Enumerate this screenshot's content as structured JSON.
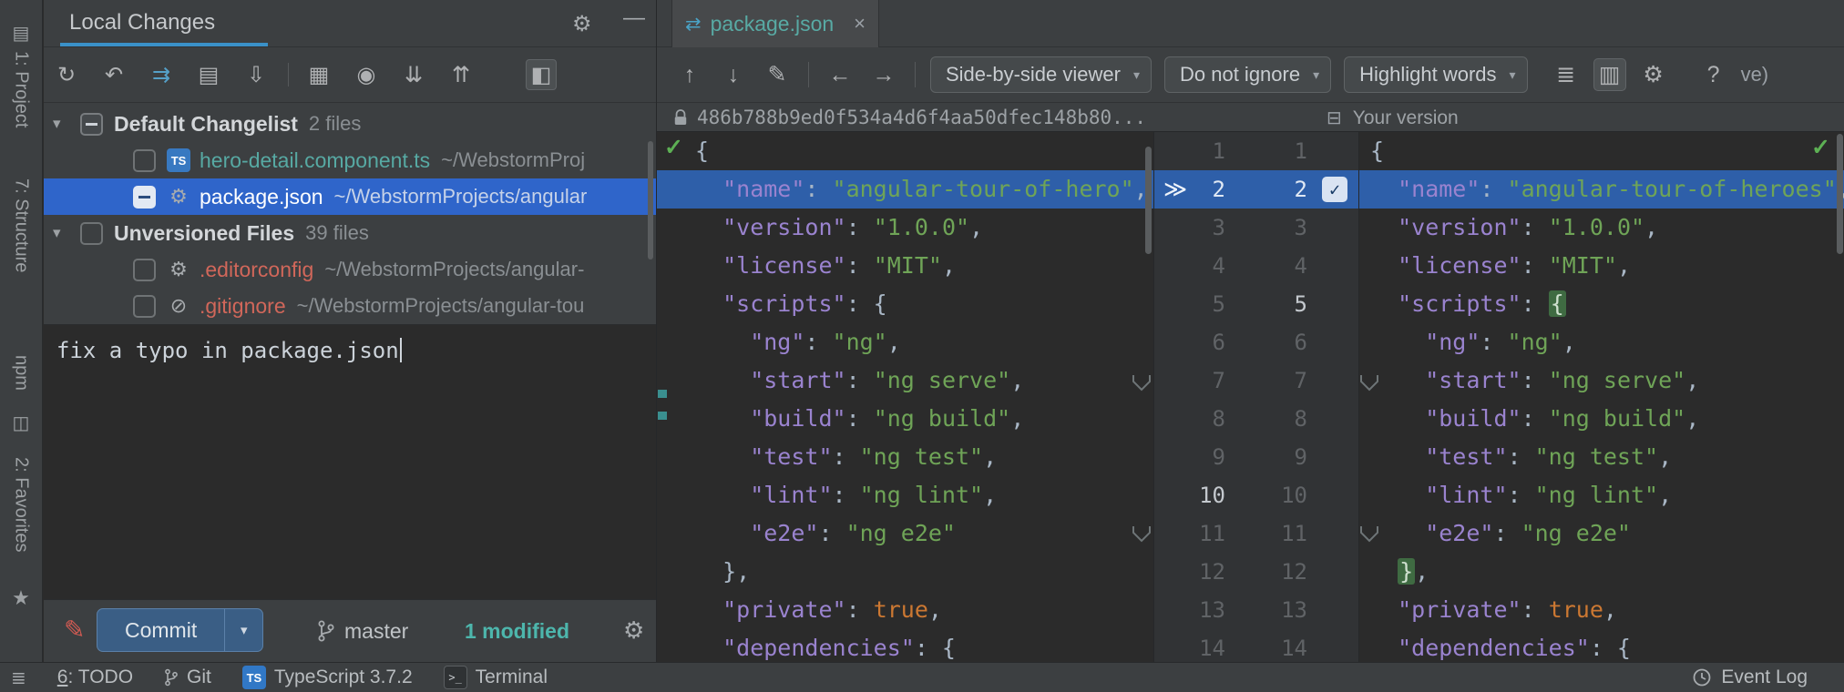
{
  "icons": {
    "gear": "⚙",
    "minimize": "—",
    "caret_down": "▾",
    "close": "×",
    "diff": "⇄",
    "star": "★",
    "project": "▤",
    "window": "◫",
    "menu": "≣",
    "check": "✓",
    "chevrons": "≫",
    "minus_box": "⊟"
  },
  "tool_stripe": {
    "project": "1: Project",
    "structure": "7: Structure",
    "npm": "npm",
    "favorites": "2: Favorites"
  },
  "local_changes": {
    "title": "Local Changes",
    "toolbar": [
      {
        "type": "icon",
        "name": "refresh-icon",
        "glyph": "↻"
      },
      {
        "type": "icon",
        "name": "rollback-icon",
        "glyph": "↶"
      },
      {
        "type": "icon",
        "name": "move-to-changelist-icon",
        "glyph": "⇉",
        "color": "#55a0c8"
      },
      {
        "type": "icon",
        "name": "show-diff-icon",
        "glyph": "▤"
      },
      {
        "type": "icon",
        "name": "shelve-icon",
        "glyph": "⇩"
      },
      {
        "type": "divider"
      },
      {
        "type": "icon",
        "name": "group-by-icon",
        "glyph": "▦"
      },
      {
        "type": "icon",
        "name": "preview-diff-icon",
        "glyph": "◉"
      },
      {
        "type": "icon",
        "name": "expand-all-icon",
        "glyph": "⇊"
      },
      {
        "type": "icon",
        "name": "collapse-all-icon",
        "glyph": "⇈"
      },
      {
        "type": "icon",
        "name": "toggle-details-icon",
        "glyph": "◧",
        "active": true,
        "gap": 36
      }
    ],
    "tree": [
      {
        "kind": "group",
        "label": "Default Changelist",
        "meta": "2 files",
        "checkbox": "partial",
        "arrow": true
      },
      {
        "kind": "file",
        "icon": "ts",
        "label": "hero-detail.component.ts",
        "path": "~/WebstormProj",
        "color": "modified",
        "checkbox": "unchecked"
      },
      {
        "kind": "file",
        "icon": "package",
        "label": "package.json",
        "path": "~/WebstormProjects/angular",
        "color": "default",
        "checkbox": "partial",
        "selected": true
      },
      {
        "kind": "group",
        "label": "Unversioned Files",
        "meta": "39 files",
        "checkbox": "unchecked",
        "arrow": true
      },
      {
        "kind": "file",
        "icon": "gear",
        "label": ".editorconfig",
        "path": "~/WebstormProjects/angular-",
        "color": "unversioned",
        "checkbox": "unchecked"
      },
      {
        "kind": "file",
        "icon": "ignore",
        "label": ".gitignore",
        "path": "~/WebstormProjects/angular-tou",
        "color": "unversioned",
        "checkbox": "unchecked"
      }
    ],
    "commit_message": "fix a typo in package.json",
    "commit_button_label": "Commit",
    "branch": "master",
    "modified_badge": "1 modified"
  },
  "diff": {
    "tab_label": "package.json",
    "toolbar_items": [
      {
        "type": "icon",
        "name": "previous-change-icon",
        "glyph": "↑"
      },
      {
        "type": "icon",
        "name": "next-change-icon",
        "glyph": "↓"
      },
      {
        "type": "icon",
        "name": "jump-to-source-icon",
        "glyph": "✎"
      },
      {
        "type": "divider"
      },
      {
        "type": "icon",
        "name": "back-icon",
        "glyph": "←"
      },
      {
        "type": "icon",
        "name": "forward-icon",
        "glyph": "→"
      },
      {
        "type": "divider"
      },
      {
        "type": "dropdown",
        "name": "viewer-mode-dropdown",
        "label": "Side-by-side viewer"
      },
      {
        "type": "dropdown",
        "name": "whitespace-dropdown",
        "label": "Do not ignore"
      },
      {
        "type": "dropdown",
        "name": "highlight-mode-dropdown",
        "label": "Highlight words"
      },
      {
        "type": "icon",
        "name": "collapse-unchanged-icon",
        "glyph": "≣",
        "gap": 10
      },
      {
        "type": "icon",
        "name": "two-columns-icon",
        "glyph": "▥",
        "boxed": true
      },
      {
        "type": "icon",
        "name": "settings-gear-icon",
        "glyph": "⚙"
      },
      {
        "type": "icon",
        "name": "help-icon",
        "glyph": "?",
        "gap": 18
      },
      {
        "type": "text",
        "name": "clipped-text",
        "label": "ve)"
      }
    ],
    "left_title": "486b788b9ed0f534a4d6f4aa50dfec148b80...",
    "right_title": "Your version",
    "left_lines": [
      {
        "t": [
          [
            "p",
            "{"
          ]
        ]
      },
      {
        "sel": true,
        "t": [
          [
            "k",
            "  \"name\""
          ],
          [
            "p",
            ": "
          ],
          [
            "s",
            "\"angular-tour-of-hero\""
          ],
          [
            "p",
            ","
          ]
        ]
      },
      {
        "t": [
          [
            "k",
            "  \"version\""
          ],
          [
            "p",
            ": "
          ],
          [
            "s",
            "\"1.0.0\""
          ],
          [
            "p",
            ","
          ]
        ]
      },
      {
        "t": [
          [
            "k",
            "  \"license\""
          ],
          [
            "p",
            ": "
          ],
          [
            "s",
            "\"MIT\""
          ],
          [
            "p",
            ","
          ]
        ]
      },
      {
        "t": [
          [
            "k",
            "  \"scripts\""
          ],
          [
            "p",
            ": {"
          ]
        ]
      },
      {
        "t": [
          [
            "k",
            "    \"ng\""
          ],
          [
            "p",
            ": "
          ],
          [
            "s",
            "\"ng\""
          ],
          [
            "p",
            ","
          ]
        ]
      },
      {
        "t": [
          [
            "k",
            "    \"start\""
          ],
          [
            "p",
            ": "
          ],
          [
            "s",
            "\"ng serve\""
          ],
          [
            "p",
            ","
          ]
        ]
      },
      {
        "t": [
          [
            "k",
            "    \"build\""
          ],
          [
            "p",
            ": "
          ],
          [
            "s",
            "\"ng build\""
          ],
          [
            "p",
            ","
          ]
        ]
      },
      {
        "t": [
          [
            "k",
            "    \"test\""
          ],
          [
            "p",
            ": "
          ],
          [
            "s",
            "\"ng test\""
          ],
          [
            "p",
            ","
          ]
        ]
      },
      {
        "t": [
          [
            "k",
            "    \"lint\""
          ],
          [
            "p",
            ": "
          ],
          [
            "s",
            "\"ng lint\""
          ],
          [
            "p",
            ","
          ]
        ]
      },
      {
        "t": [
          [
            "k",
            "    \"e2e\""
          ],
          [
            "p",
            ": "
          ],
          [
            "s",
            "\"ng e2e\""
          ]
        ]
      },
      {
        "t": [
          [
            "p",
            "  },"
          ]
        ]
      },
      {
        "t": [
          [
            "k",
            "  \"private\""
          ],
          [
            "p",
            ": "
          ],
          [
            "b",
            "true"
          ],
          [
            "p",
            ","
          ]
        ]
      },
      {
        "t": [
          [
            "k",
            "  \"dependencies\""
          ],
          [
            "p",
            ": {"
          ]
        ]
      }
    ],
    "right_lines": [
      {
        "t": [
          [
            "p",
            "{"
          ]
        ]
      },
      {
        "sel": true,
        "t": [
          [
            "k",
            "  \"name\""
          ],
          [
            "p",
            ": "
          ],
          [
            "s",
            "\"angular-tour-of-heroes\""
          ],
          [
            "p",
            ","
          ]
        ]
      },
      {
        "t": [
          [
            "k",
            "  \"version\""
          ],
          [
            "p",
            ": "
          ],
          [
            "s",
            "\"1.0.0\""
          ],
          [
            "p",
            ","
          ]
        ]
      },
      {
        "t": [
          [
            "k",
            "  \"license\""
          ],
          [
            "p",
            ": "
          ],
          [
            "s",
            "\"MIT\""
          ],
          [
            "p",
            ","
          ]
        ]
      },
      {
        "t": [
          [
            "k",
            "  \"scripts\""
          ],
          [
            "p",
            ": "
          ],
          [
            "hi",
            "{"
          ]
        ]
      },
      {
        "t": [
          [
            "k",
            "    \"ng\""
          ],
          [
            "p",
            ": "
          ],
          [
            "s",
            "\"ng\""
          ],
          [
            "p",
            ","
          ]
        ]
      },
      {
        "t": [
          [
            "k",
            "    \"start\""
          ],
          [
            "p",
            ": "
          ],
          [
            "s",
            "\"ng serve\""
          ],
          [
            "p",
            ","
          ]
        ]
      },
      {
        "t": [
          [
            "k",
            "    \"build\""
          ],
          [
            "p",
            ": "
          ],
          [
            "s",
            "\"ng build\""
          ],
          [
            "p",
            ","
          ]
        ]
      },
      {
        "t": [
          [
            "k",
            "    \"test\""
          ],
          [
            "p",
            ": "
          ],
          [
            "s",
            "\"ng test\""
          ],
          [
            "p",
            ","
          ]
        ]
      },
      {
        "t": [
          [
            "k",
            "    \"lint\""
          ],
          [
            "p",
            ": "
          ],
          [
            "s",
            "\"ng lint\""
          ],
          [
            "p",
            ","
          ]
        ]
      },
      {
        "t": [
          [
            "k",
            "    \"e2e\""
          ],
          [
            "p",
            ": "
          ],
          [
            "s",
            "\"ng e2e\""
          ]
        ]
      },
      {
        "t": [
          [
            "p",
            "  "
          ],
          [
            "hi",
            "}"
          ],
          [
            "p",
            ","
          ]
        ]
      },
      {
        "t": [
          [
            "k",
            "  \"private\""
          ],
          [
            "p",
            ": "
          ],
          [
            "b",
            "true"
          ],
          [
            "p",
            ","
          ]
        ]
      },
      {
        "t": [
          [
            "k",
            "  \"dependencies\""
          ],
          [
            "p",
            ": {"
          ]
        ]
      }
    ],
    "gutter": {
      "left_numbers": [
        1,
        2,
        3,
        4,
        5,
        6,
        7,
        8,
        9,
        10,
        11,
        12,
        13,
        14
      ],
      "right_numbers": [
        1,
        2,
        3,
        4,
        5,
        6,
        7,
        8,
        9,
        10,
        11,
        12,
        13,
        14
      ],
      "selected": 2,
      "left_bright": [
        2,
        10
      ],
      "right_bright": [
        2,
        5
      ]
    }
  },
  "status_bar": {
    "todo_number": "6",
    "todo_text": ": TODO",
    "git": "Git",
    "ts_badge": "TS",
    "typescript": "TypeScript 3.7.2",
    "terminal": "Terminal",
    "event_log": "Event Log"
  }
}
